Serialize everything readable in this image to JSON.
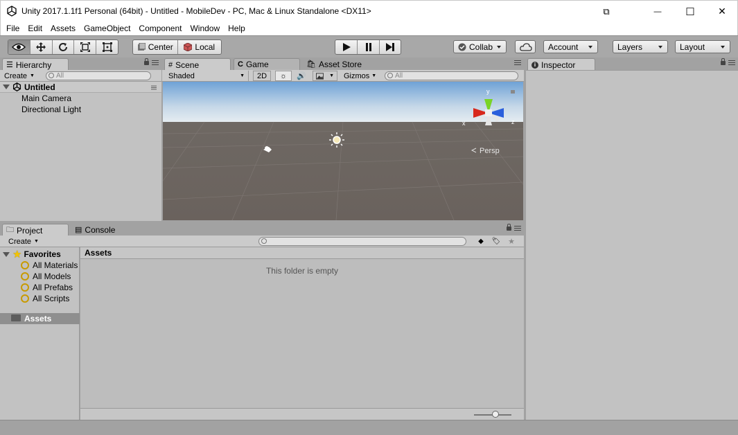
{
  "window": {
    "title": "Unity 2017.1.1f1 Personal (64bit) - Untitled - MobileDev - PC, Mac & Linux Standalone <DX11>",
    "restore_glyph": "⧉",
    "minimize_glyph": "—",
    "maximize_glyph": "☐",
    "close_glyph": "✕"
  },
  "menu": [
    "File",
    "Edit",
    "Assets",
    "GameObject",
    "Component",
    "Window",
    "Help"
  ],
  "toolbar": {
    "tools": [
      "view-tool",
      "move-tool",
      "rotate-tool",
      "scale-tool",
      "rect-tool"
    ],
    "pivot_label": "Center",
    "space_label": "Local",
    "collab_label": "Collab",
    "account_label": "Account",
    "layers_label": "Layers",
    "layout_label": "Layout"
  },
  "hierarchy": {
    "tab_label": "Hierarchy",
    "create_label": "Create",
    "search_placeholder": "All",
    "scene_name": "Untitled",
    "items": [
      "Main Camera",
      "Directional Light"
    ]
  },
  "scene": {
    "tabs": [
      {
        "label": "Scene"
      },
      {
        "label": "Game"
      },
      {
        "label": "Asset Store"
      }
    ],
    "shading_label": "Shaded",
    "mode_2d_label": "2D",
    "gizmos_label": "Gizmos",
    "search_placeholder": "All",
    "persp_label": "Persp",
    "axis_y": "y",
    "axis_x": "x",
    "axis_z": "z",
    "colors": {
      "x_axis": "#d8281c",
      "y_axis": "#7ad426",
      "z_axis": "#2a5fdc",
      "sky": "#c8d8e8",
      "ground": "#6f6a66"
    }
  },
  "inspector": {
    "tab_label": "Inspector"
  },
  "project": {
    "tabs": [
      {
        "label": "Project"
      },
      {
        "label": "Console"
      }
    ],
    "create_label": "Create",
    "favorites_label": "Favorites",
    "favorites": [
      "All Materials",
      "All Models",
      "All Prefabs",
      "All Scripts"
    ],
    "assets_label": "Assets",
    "breadcrumb": "Assets",
    "empty_message": "This folder is empty"
  }
}
